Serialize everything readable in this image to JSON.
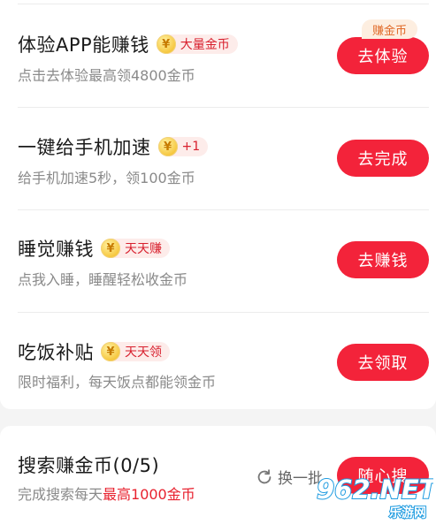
{
  "tasks": [
    {
      "title": "体验APP能赚钱",
      "tag": "大量金币",
      "subtitle": "点击去体验最高领4800金币",
      "button": "去体验",
      "badge": "赚金币"
    },
    {
      "title": "一键给手机加速",
      "tag": "+1",
      "subtitle": "给手机加速5秒，领100金币",
      "button": "去完成"
    },
    {
      "title": "睡觉赚钱",
      "tag": "天天赚",
      "subtitle": "点我入睡，睡醒轻松收金币",
      "button": "去赚钱"
    },
    {
      "title": "吃饭补贴",
      "tag": "天天领",
      "subtitle": "限时福利，每天饭点都能领金币",
      "button": "去领取"
    }
  ],
  "coin_glyph": "¥",
  "search_task": {
    "title": "搜索赚金币(0/5)",
    "subtitle_prefix": "完成搜索每天",
    "subtitle_highlight": "最高1000金币",
    "refresh_label": "换一批",
    "button": "随心搜"
  },
  "watermark": {
    "brand": "962.NET",
    "tagline": "乐游网"
  },
  "colors": {
    "button_red": "#f3233a",
    "tag_bg": "#fdecea",
    "tag_text": "#d8202e",
    "badge_orange": "#e06a28",
    "subtitle_gray": "#8a8a8a"
  }
}
